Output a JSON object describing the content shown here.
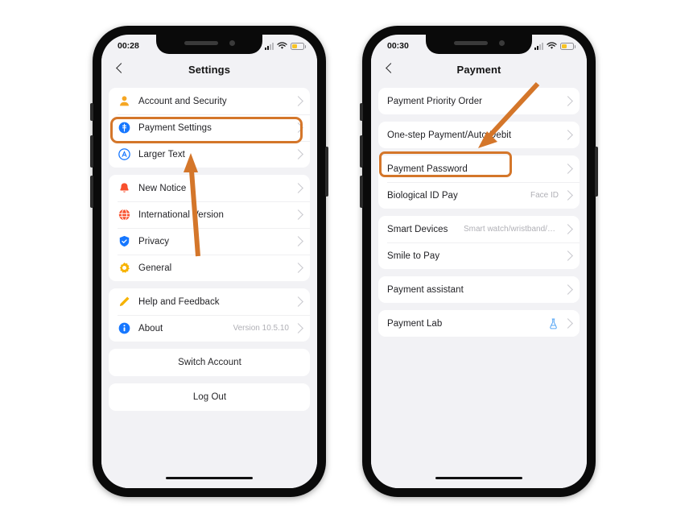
{
  "accent_color": "#d4762a",
  "phones": [
    {
      "id": "settings-phone",
      "status": {
        "time": "00:28",
        "signal": "signal-bars",
        "wifi": "wifi-icon",
        "battery": "battery-low-icon"
      },
      "nav": {
        "back": "back-chevron",
        "title": "Settings"
      },
      "groups": [
        {
          "rows": [
            {
              "icon": "person-icon",
              "label": "Account and Security",
              "value": ""
            },
            {
              "icon": "payment-icon",
              "label": "Payment Settings",
              "value": ""
            },
            {
              "icon": "larger-text-icon",
              "label": "Larger Text",
              "value": ""
            }
          ]
        },
        {
          "rows": [
            {
              "icon": "bell-icon",
              "label": "New Notice",
              "value": ""
            },
            {
              "icon": "globe-icon",
              "label": "International Version",
              "value": ""
            },
            {
              "icon": "shield-check-icon",
              "label": "Privacy",
              "value": ""
            },
            {
              "icon": "gear-icon",
              "label": "General",
              "value": ""
            }
          ]
        },
        {
          "rows": [
            {
              "icon": "pencil-icon",
              "label": "Help and Feedback",
              "value": ""
            },
            {
              "icon": "info-icon",
              "label": "About",
              "value": "Version 10.5.10"
            }
          ]
        },
        {
          "center": true,
          "rows": [
            {
              "icon": "",
              "label": "Switch Account",
              "value": ""
            }
          ]
        },
        {
          "center": true,
          "rows": [
            {
              "icon": "",
              "label": "Log Out",
              "value": ""
            }
          ]
        }
      ]
    },
    {
      "id": "payment-phone",
      "status": {
        "time": "00:30",
        "signal": "signal-bars",
        "wifi": "wifi-icon",
        "battery": "battery-low-icon"
      },
      "nav": {
        "back": "back-chevron",
        "title": "Payment"
      },
      "groups": [
        {
          "rows": [
            {
              "icon": "",
              "label": "Payment Priority Order",
              "value": ""
            }
          ]
        },
        {
          "rows": [
            {
              "icon": "",
              "label": "One-step Payment/Auto Debit",
              "value": ""
            }
          ]
        },
        {
          "rows": [
            {
              "icon": "",
              "label": "Payment Password",
              "value": ""
            },
            {
              "icon": "",
              "label": "Biological ID Pay",
              "value": "Face ID"
            }
          ]
        },
        {
          "rows": [
            {
              "icon": "",
              "label": "Smart Devices",
              "value": "Smart watch/wristband/card,a..."
            },
            {
              "icon": "",
              "label": "Smile to Pay",
              "value": ""
            }
          ]
        },
        {
          "rows": [
            {
              "icon": "",
              "label": "Payment assistant",
              "value": ""
            }
          ]
        },
        {
          "rows": [
            {
              "icon": "",
              "label": "Payment Lab",
              "value": "",
              "trail_icon": "flask-icon"
            }
          ]
        }
      ]
    }
  ],
  "annotations": {
    "highlight_1_target": "Payment Settings",
    "highlight_2_target": "Payment Password",
    "arrow_1": "arrow-up-to-payment-settings",
    "arrow_2": "arrow-down-to-payment-password"
  }
}
